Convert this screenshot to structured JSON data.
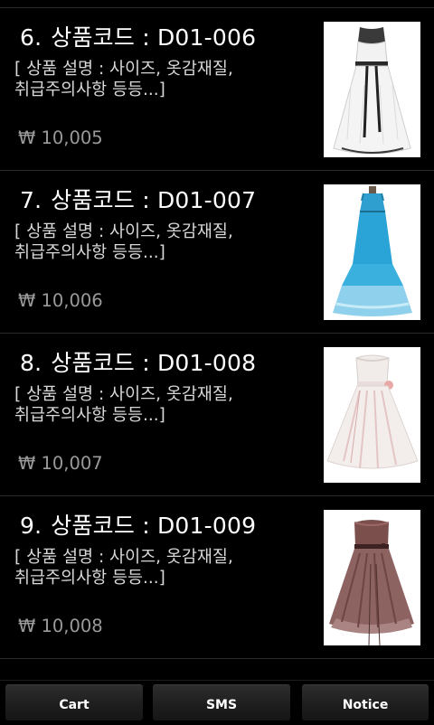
{
  "products": [
    {
      "number": "6.",
      "title": "상품코드 : D01-006",
      "description_line1": "[ 상품 설명 : 사이즈, 옷감재질,",
      "description_line2": "취급주의사항 등등...]",
      "price": "₩ 10,005",
      "image": "white-black-sash-dress"
    },
    {
      "number": "7.",
      "title": "상품코드 : D01-007",
      "description_line1": "[ 상품 설명 : 사이즈, 옷감재질,",
      "description_line2": "취급주의사항 등등...]",
      "price": "₩ 10,006",
      "image": "blue-tiered-dress"
    },
    {
      "number": "8.",
      "title": "상품코드 : D01-008",
      "description_line1": "[ 상품 설명 : 사이즈, 옷감재질,",
      "description_line2": "취급주의사항 등등...]",
      "price": "₩ 10,007",
      "image": "white-pink-party-dress"
    },
    {
      "number": "9.",
      "title": "상품코드 : D01-009",
      "description_line1": "[ 상품 설명 : 사이즈, 옷감재질,",
      "description_line2": "취급주의사항 등등...]",
      "price": "₩ 10,008",
      "image": "brown-tulle-dress"
    }
  ],
  "bottom_bar": {
    "cart_label": "Cart",
    "sms_label": "SMS",
    "notice_label": "Notice"
  },
  "colors": {
    "background": "#000000",
    "title_text": "#ffffff",
    "description_text": "#d8d8d8",
    "price_text": "#9a9a9a",
    "divider": "#2b2b2b"
  }
}
